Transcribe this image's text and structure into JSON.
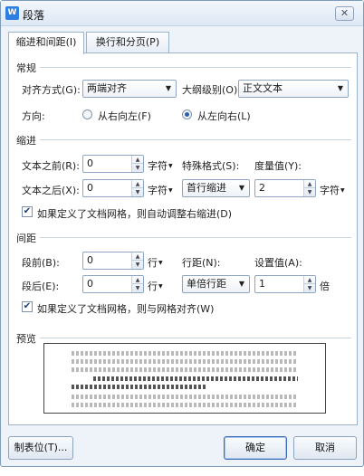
{
  "window": {
    "title": "段落",
    "close_glyph": "✕",
    "icon_letter": "W"
  },
  "tabs": [
    {
      "label": "缩进和间距(I)",
      "active": true
    },
    {
      "label": "换行和分页(P)",
      "active": false
    }
  ],
  "general": {
    "section_title": "常规",
    "alignment_label": "对齐方式(G):",
    "alignment_value": "两端对齐",
    "outline_label": "大纲级别(O):",
    "outline_value": "正文文本",
    "direction_label": "方向:",
    "direction_rtl": "从右向左(F)",
    "direction_ltr": "从左向右(L)",
    "direction_selected": "ltr"
  },
  "indent": {
    "section_title": "缩进",
    "before_label": "文本之前(R):",
    "before_value": "0",
    "before_unit": "字符",
    "after_label": "文本之后(X):",
    "after_value": "0",
    "after_unit": "字符",
    "special_label": "特殊格式(S):",
    "special_value": "首行缩进",
    "measure_label": "度量值(Y):",
    "measure_value": "2",
    "measure_unit": "字符",
    "grid_checkbox_label": "如果定义了文档网格，则自动调整右缩进(D)",
    "grid_checked": true
  },
  "spacing": {
    "section_title": "间距",
    "before_label": "段前(B):",
    "before_value": "0",
    "before_unit": "行",
    "after_label": "段后(E):",
    "after_value": "0",
    "after_unit": "行",
    "line_label": "行距(N):",
    "line_value": "单倍行距",
    "setting_label": "设置值(A):",
    "setting_value": "1",
    "setting_unit": "倍",
    "grid_checkbox_label": "如果定义了文档网格，则与网格对齐(W)",
    "grid_checked": true
  },
  "preview": {
    "section_title": "预览"
  },
  "buttons": {
    "tabs": "制表位(T)...",
    "ok": "确定",
    "cancel": "取消"
  },
  "icons": {
    "spin_up": "▲",
    "spin_down": "▼",
    "dropdown": "▼",
    "unit_dropdown": "▼",
    "check": "✔"
  }
}
